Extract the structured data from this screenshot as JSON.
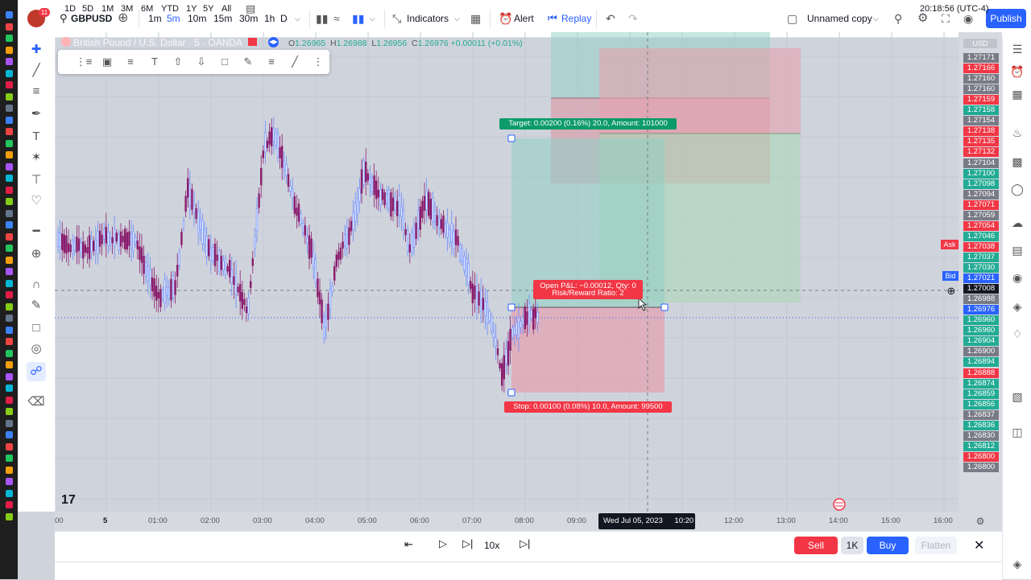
{
  "topbar": {
    "avatar_badge": "11",
    "symbol": "GBPUSD",
    "intervals": [
      "1m",
      "5m",
      "10m",
      "15m",
      "30m",
      "1h",
      "D"
    ],
    "active_interval": "5m",
    "indicators": "Indicators",
    "alert": "Alert",
    "replay": "Replay",
    "layout_name": "Unnamed copy",
    "publish": "Publish"
  },
  "legend": {
    "title": "British Pound / U.S. Dollar · 5 · OANDA",
    "o_label": "O",
    "o": "1.26965",
    "h_label": "H",
    "h": "1.26988",
    "l_label": "L",
    "l": "1.26956",
    "c_label": "C",
    "c": "1.26976",
    "change": "+0.00011 (+0.01%)"
  },
  "position": {
    "target_label": "Target: 0.00200 (0.16%) 20.0, Amount: 101000",
    "stop_label": "Stop: 0.00100 (0.08%) 10.0, Amount: 99500",
    "pnl_line1": "Open P&L: −0.00012, Qty: 0",
    "pnl_line2": "Risk/Reward Ratio: 2"
  },
  "price_axis": {
    "currency": "USD",
    "ask_label": "Ask",
    "bid_label": "Bid",
    "crosshair_price": "1.27008",
    "labels": [
      {
        "v": "1.27171",
        "c": "#787b86"
      },
      {
        "v": "1.27166",
        "c": "#f23645"
      },
      {
        "v": "1.27160",
        "c": "#787b86"
      },
      {
        "v": "1.27160",
        "c": "#787b86"
      },
      {
        "v": "1.27159",
        "c": "#f23645"
      },
      {
        "v": "1.27158",
        "c": "#22ab94"
      },
      {
        "v": "1.27154",
        "c": "#787b86"
      },
      {
        "v": "1.27138",
        "c": "#f23645"
      },
      {
        "v": "1.27135",
        "c": "#f23645"
      },
      {
        "v": "1.27132",
        "c": "#f23645"
      },
      {
        "v": "1.27104",
        "c": "#787b86"
      },
      {
        "v": "1.27100",
        "c": "#22ab94"
      },
      {
        "v": "1.27098",
        "c": "#22ab94"
      },
      {
        "v": "1.27094",
        "c": "#787b86"
      },
      {
        "v": "1.27071",
        "c": "#f23645"
      },
      {
        "v": "1.27059",
        "c": "#787b86"
      },
      {
        "v": "1.27054",
        "c": "#f23645"
      },
      {
        "v": "1.27046",
        "c": "#22ab94"
      },
      {
        "v": "1.27038",
        "c": "#f23645"
      },
      {
        "v": "1.27037",
        "c": "#22ab94"
      },
      {
        "v": "1.27030",
        "c": "#22ab94"
      },
      {
        "v": "1.27021",
        "c": "#2962ff"
      },
      {
        "v": "1.27008",
        "c": "#131722"
      },
      {
        "v": "1.26988",
        "c": "#787b86"
      },
      {
        "v": "1.26976",
        "c": "#2962ff"
      },
      {
        "v": "1.26960",
        "c": "#22ab94"
      },
      {
        "v": "1.26960",
        "c": "#22ab94"
      },
      {
        "v": "1.26904",
        "c": "#22ab94"
      },
      {
        "v": "1.26900",
        "c": "#787b86"
      },
      {
        "v": "1.26894",
        "c": "#22ab94"
      },
      {
        "v": "1.26888",
        "c": "#f23645"
      },
      {
        "v": "1.26874",
        "c": "#22ab94"
      },
      {
        "v": "1.26859",
        "c": "#22ab94"
      },
      {
        "v": "1.26856",
        "c": "#22ab94"
      },
      {
        "v": "1.26837",
        "c": "#787b86"
      },
      {
        "v": "1.26836",
        "c": "#22ab94"
      },
      {
        "v": "1.26830",
        "c": "#787b86"
      },
      {
        "v": "1.26812",
        "c": "#22ab94"
      },
      {
        "v": "1.26800",
        "c": "#f23645"
      },
      {
        "v": "1.26800",
        "c": "#787b86"
      }
    ]
  },
  "time_axis": {
    "labels": [
      "00",
      "5",
      "01:00",
      "02:00",
      "03:00",
      "04:00",
      "05:00",
      "06:00",
      "07:00",
      "08:00",
      "09:00",
      "12:00",
      "13:00",
      "14:00",
      "15:00",
      "16:00"
    ],
    "crosshair_time": "Wed Jul 05, 2023",
    "crosshair_clock": "10:20"
  },
  "replay": {
    "speed": "10x",
    "sell": "Sell",
    "qty": "1K",
    "buy": "Buy",
    "flatten": "Flatten"
  },
  "ranges": [
    "1D",
    "5D",
    "1M",
    "3M",
    "6M",
    "YTD",
    "1Y",
    "5Y",
    "All"
  ],
  "clock": "20:18:56 (UTC-4)",
  "colors": {
    "accent": "#2962ff",
    "up": "#22ab94",
    "down": "#f23645",
    "candle_up": "#6a8cff",
    "candle_down": "#8a1d6d"
  }
}
